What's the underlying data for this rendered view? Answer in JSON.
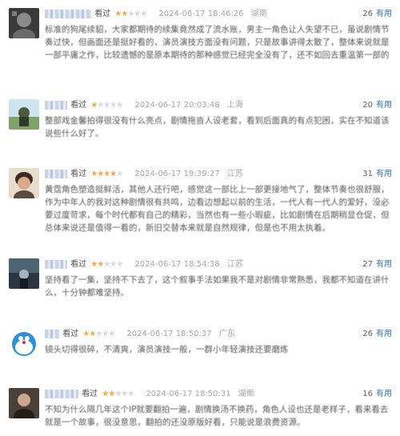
{
  "reviews": [
    {
      "status": "看过",
      "rating": 2,
      "time": "2024-06-17 18:46:26",
      "location": "湖南",
      "votes": "26",
      "useful_label": "有用",
      "text": "标准的狗尾续貂，大家都期待的续集竟然成了流水账，男主一角色让人失望不已，虽说剧情节奏过快，但画面还是挺好看的，演员演技方面没有问题，只是故事讲得太散了，整体来说就是一部平庸之作，比较遗憾的是原本期待的那种感觉已经完全没有了，还不如回去重温第一部的旧时光，那时候的故事还算不错。"
    },
    {
      "status": "看过",
      "rating": 1,
      "time": "2024-06-17 20:03:48",
      "location": "上海",
      "votes": "20",
      "useful_label": "有用",
      "text": "整部戏金馨拍得很没有什么亮点，剧情拖沓人设老套，看到后面真的有点犯困，实在不知道该说些什么好了。"
    },
    {
      "status": "看过",
      "rating": 4,
      "time": "2024-06-17 19:39:27",
      "location": "江苏",
      "votes": "31",
      "useful_label": "有用",
      "text": "黄霑角色塑造挺鲜活，其他人还行吧，感觉这一部比上一部更接地气了，整体节奏也很舒服，作为中年人的我对这种剧情很有共鸣，边看边想起以前的生活，一代人有一代人的爱好，没必要过度苛求，每个时代都有自己的精彩，当然也有一些小瑕疵，比如剧情在后期稍显仓促，但总体来说还是值得一看的，新旧交替本来就是自然规律，但是也不用太执着。"
    },
    {
      "status": "看过",
      "rating": 2,
      "time": "2024-06-17 18:54:38",
      "location": "江苏",
      "votes": "27",
      "useful_label": "有用",
      "text": "坚持看了一集，坚持不下去了，这个叙事手法如果我不是对剧情非常熟悉，我都不知道在讲什么，十分钟都难坚持。"
    },
    {
      "status": "看过",
      "rating": 2,
      "time": "2024-06-17 18:50:37",
      "location": "广东",
      "votes": "26",
      "useful_label": "有用",
      "text": "镜头切得很碎，不清爽，演员演技一般，一群小年轻演技还要磨炼"
    },
    {
      "status": "看过",
      "rating": 2,
      "time": "2024-06-17 18:50:31",
      "location": "湖南",
      "votes": "16",
      "useful_label": "有用",
      "text": "不知为什么隔几年这个IP就要翻拍一遍，剧情换汤不换药，角色人设也还是老样子，看来看去就是一个故事，很没意思，翻拍的还没原版好看，只能说是浪费资源。"
    }
  ]
}
